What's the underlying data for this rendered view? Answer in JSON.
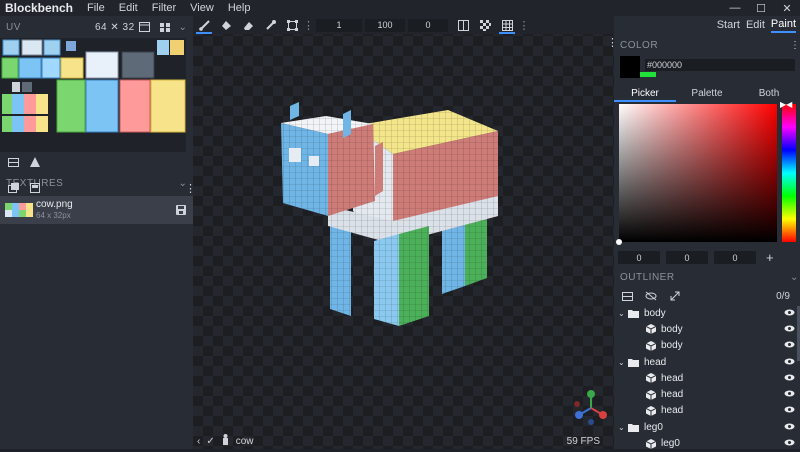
{
  "app": {
    "title": "Blockbench"
  },
  "menu": [
    "File",
    "Edit",
    "Filter",
    "View",
    "Help"
  ],
  "window_controls": [
    "minimize-icon",
    "maximize-icon",
    "close-icon"
  ],
  "uv_panel": {
    "title": "UV",
    "size": "64 ✕ 32"
  },
  "textures_panel": {
    "title": "TEXTURES",
    "item": {
      "name": "cow.png",
      "size": "64 x 32px"
    }
  },
  "toolbar": {
    "brush_size": "1",
    "opacity": "100",
    "softness": "0"
  },
  "modes": [
    "Start",
    "Edit",
    "Paint"
  ],
  "active_mode": "Paint",
  "color_panel": {
    "title": "COLOR",
    "hex": "#000000",
    "tabs": [
      "Picker",
      "Palette",
      "Both"
    ],
    "active_tab": "Picker",
    "rgb": [
      "0",
      "0",
      "0"
    ]
  },
  "outliner": {
    "title": "OUTLINER",
    "count": "0/9",
    "items": [
      {
        "type": "folder",
        "label": "body",
        "indent": 0
      },
      {
        "type": "cube",
        "label": "body",
        "indent": 1
      },
      {
        "type": "cube",
        "label": "body",
        "indent": 1
      },
      {
        "type": "folder",
        "label": "head",
        "indent": 0
      },
      {
        "type": "cube",
        "label": "head",
        "indent": 1
      },
      {
        "type": "cube",
        "label": "head",
        "indent": 1
      },
      {
        "type": "cube",
        "label": "head",
        "indent": 1
      },
      {
        "type": "folder",
        "label": "leg0",
        "indent": 0
      },
      {
        "type": "cube",
        "label": "leg0",
        "indent": 1
      }
    ]
  },
  "bottom": {
    "model_name": "cow",
    "fps": "59 FPS"
  }
}
